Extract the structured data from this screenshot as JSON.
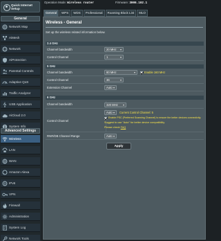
{
  "topbar": {
    "op_mode_label": "Operation Mode:",
    "op_mode_value": "Wireless router",
    "firmware_label": "Firmware:",
    "firmware_value": "3006.102.1"
  },
  "sidebar": {
    "quick_setup": "Quick Internet\nSetup",
    "general_header": "General",
    "general_items": [
      {
        "label": "Network Map",
        "icon": "network-map-icon"
      },
      {
        "label": "AiMesh",
        "icon": "aimesh-icon"
      },
      {
        "label": "Network",
        "icon": "network-icon"
      },
      {
        "label": "AiProtection",
        "icon": "shield-icon"
      },
      {
        "label": "Parental Controls",
        "icon": "parental-controls-icon"
      },
      {
        "label": "Adaptive QoS",
        "icon": "qos-icon"
      },
      {
        "label": "Traffic Analyzer",
        "icon": "traffic-analyzer-icon"
      },
      {
        "label": "USB Application",
        "icon": "usb-icon"
      },
      {
        "label": "AiCloud 2.0",
        "icon": "cloud-icon"
      },
      {
        "label": "System Info",
        "icon": "system-info-icon"
      }
    ],
    "advanced_header": "Advanced Settings",
    "advanced_items": [
      {
        "label": "Wireless",
        "icon": "wireless-icon",
        "active": true
      },
      {
        "label": "LAN",
        "icon": "lan-icon"
      },
      {
        "label": "WAN",
        "icon": "wan-icon"
      },
      {
        "label": "Amazon Alexa",
        "icon": "alexa-icon"
      },
      {
        "label": "IPv6",
        "icon": "ipv6-icon"
      },
      {
        "label": "VPN",
        "icon": "vpn-icon"
      },
      {
        "label": "Firewall",
        "icon": "firewall-icon"
      },
      {
        "label": "Administration",
        "icon": "administration-icon"
      },
      {
        "label": "System Log",
        "icon": "system-log-icon"
      },
      {
        "label": "Network Tools",
        "icon": "network-tools-icon"
      }
    ]
  },
  "tabs": [
    "General",
    "WPS",
    "WDS",
    "Professional",
    "Roaming Block List",
    "MLO"
  ],
  "active_tab": "General",
  "main": {
    "title": "Wireless - General",
    "description": "Set up the wireless related information below.",
    "band_24": {
      "label": "2.4 GHz",
      "channel_bandwidth_label": "Channel bandwidth",
      "channel_bandwidth_value": "20 MHz",
      "control_channel_label": "Control Channel",
      "control_channel_value": "1"
    },
    "band_5": {
      "label": "5 GHz",
      "channel_bandwidth_label": "Channel bandwidth",
      "channel_bandwidth_value": "80 MHz",
      "enable_160_label": "Enable 160 MHz",
      "control_channel_label": "Control Channel",
      "control_channel_value": "36",
      "extension_channel_label": "Extension Channel",
      "extension_channel_value": "Auto"
    },
    "band_6": {
      "label": "6 GHz",
      "channel_bandwidth_label": "Channel bandwidth",
      "channel_bandwidth_value": "320 MHz",
      "control_channel_label": "Control Channel",
      "control_channel_value": "Auto",
      "current_channel_text": "Current Control Channel: 5",
      "psc_label": "Enable PSC (Preferred Scanning Channel) to ensure the better devices connectivity.",
      "suggest_text": "Suggest to use \"Auto\" for better device compatibility.",
      "faq_prefix": "Please check",
      "faq_link": "FAQ",
      "rnr_label": "RNR/DB Channel Range",
      "rnr_value": "Auto"
    },
    "apply_label": "Apply"
  },
  "colors": {
    "accent_active_nav": "#3a5f82",
    "note_yellow": "#f6e14a",
    "panel_bg": "#4d5a60"
  }
}
